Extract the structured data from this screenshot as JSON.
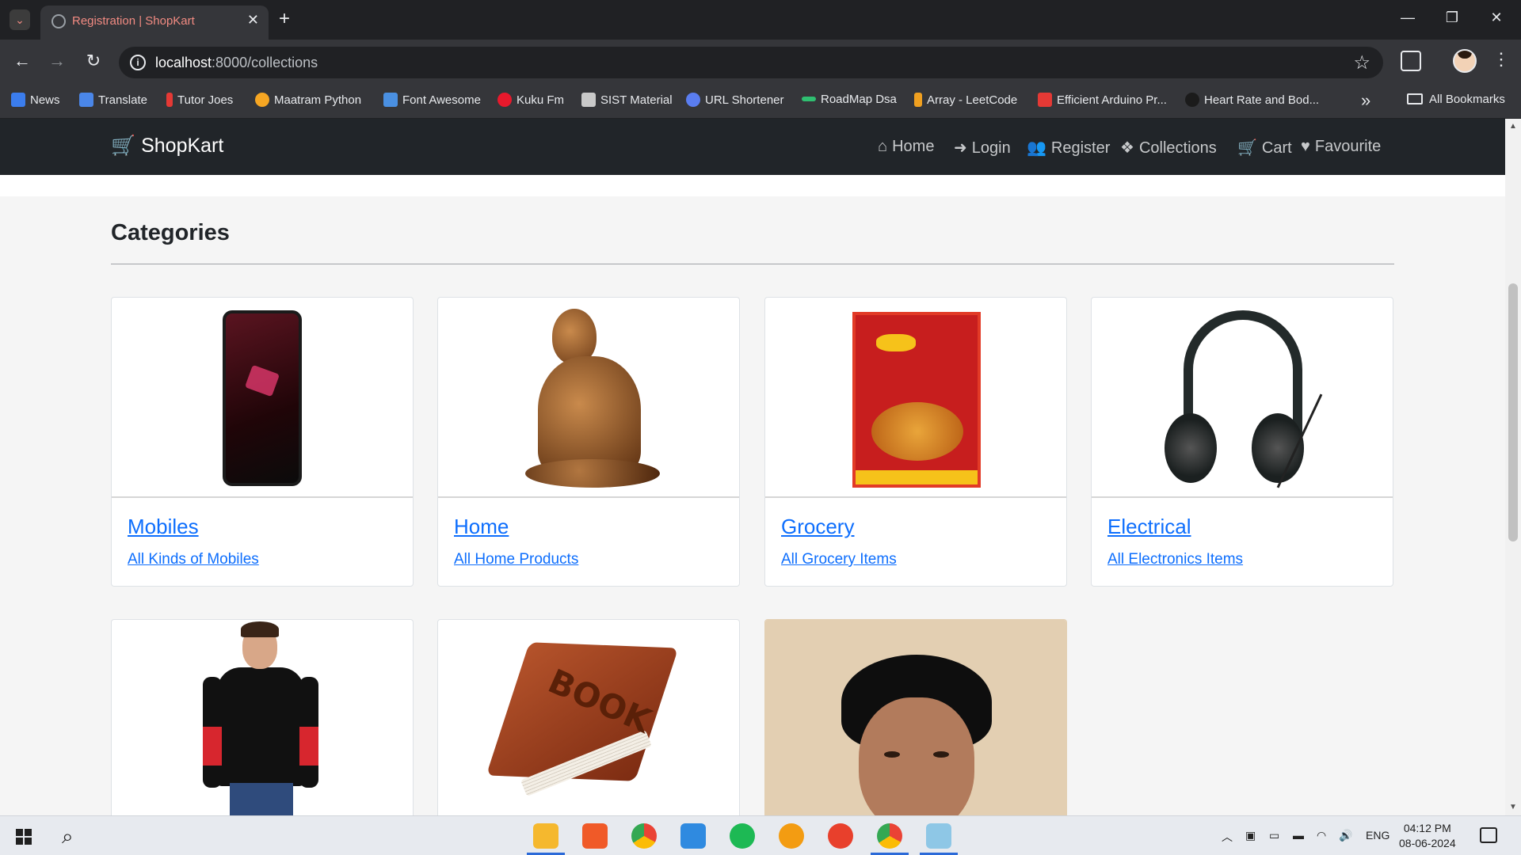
{
  "browser": {
    "tab_title": "Registration | ShopKart",
    "url_host": "localhost",
    "url_path": ":8000/collections"
  },
  "bookmarks": [
    {
      "label": "News",
      "icon": "news-icon",
      "color": "#3b7ded"
    },
    {
      "label": "Translate",
      "icon": "translate-icon",
      "color": "#4a86e8"
    },
    {
      "label": "Tutor Joes",
      "icon": "tutorjoes-icon",
      "color": "#e53935"
    },
    {
      "label": "Maatram Python",
      "icon": "infinity-icon",
      "color": "#f6a623"
    },
    {
      "label": "Font Awesome",
      "icon": "flag-icon",
      "color": "#4a90e2"
    },
    {
      "label": "Kuku Fm",
      "icon": "kukufm-icon",
      "color": "#e8192c"
    },
    {
      "label": "SIST Material",
      "icon": "sist-icon",
      "color": "#c9c9c9"
    },
    {
      "label": "URL Shortener",
      "icon": "link-icon",
      "color": "#5a7df0"
    },
    {
      "label": "RoadMap Dsa",
      "icon": "roadmap-icon",
      "color": "#2fbf71"
    },
    {
      "label": "Array - LeetCode",
      "icon": "leetcode-icon",
      "color": "#f0a020"
    },
    {
      "label": "Efficient Arduino Pr...",
      "icon": "pdf-icon",
      "color": "#e53935"
    },
    {
      "label": "Heart Rate and Bod...",
      "icon": "heart-rate-icon",
      "color": "#1b1b1b"
    }
  ],
  "all_bookmarks_label": "All Bookmarks",
  "site": {
    "brand": "ShopKart",
    "nav": [
      {
        "label": "Home",
        "icon": "home-icon",
        "glyph": "⌂"
      },
      {
        "label": "Login",
        "icon": "login-icon",
        "glyph": "➜"
      },
      {
        "label": "Register",
        "icon": "users-icon",
        "glyph": "👥"
      },
      {
        "label": "Collections",
        "icon": "cubes-icon",
        "glyph": "❖"
      },
      {
        "label": "Cart",
        "icon": "cart-icon",
        "glyph": "🛒"
      },
      {
        "label": "Favourite",
        "icon": "heart-icon",
        "glyph": "♥"
      }
    ]
  },
  "main": {
    "heading": "Categories",
    "categories": [
      {
        "title": "Mobiles",
        "subtitle": "All Kinds of Mobiles",
        "image": "mobile-phone-image"
      },
      {
        "title": "Home",
        "subtitle": "All Home Products",
        "image": "buddha-statue-image"
      },
      {
        "title": "Grocery",
        "subtitle": "All Grocery Items",
        "image": "maggi-noodles-image"
      },
      {
        "title": "Electrical",
        "subtitle": "All Electronics Items",
        "image": "headphones-image"
      },
      {
        "title": "",
        "subtitle": "",
        "image": "hoodie-image"
      },
      {
        "title": "",
        "subtitle": "",
        "image": "book-image",
        "image_text": "BOOK"
      },
      {
        "title": "",
        "subtitle": "",
        "image": "portrait-image"
      }
    ]
  },
  "taskbar": {
    "apps": [
      "file-explorer-icon",
      "pdf-reader-icon",
      "chrome-icon",
      "vscode-icon",
      "spotify-icon",
      "search-app-icon",
      "wps-office-icon",
      "chrome-profile-icon",
      "notepad-icon"
    ],
    "language": "ENG",
    "time": "04:12 PM",
    "date": "08-06-2024"
  }
}
